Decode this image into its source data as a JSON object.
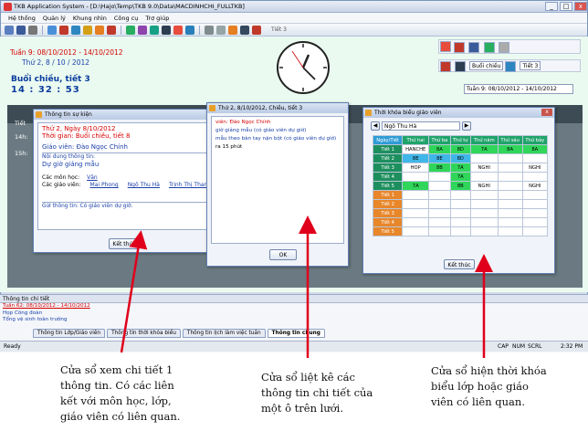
{
  "app": {
    "title": "TKB Application System - [D:\\Hajo\\Temp\\TKB 9.0\\Data\\MACDINHCHI_FULLTKB]"
  },
  "menu": [
    "Hệ thống",
    "Quản lý",
    "Khung nhìn",
    "Công cụ",
    "Trợ giúp"
  ],
  "toolbar": {
    "label": "Tiết 3"
  },
  "header": {
    "week": "Tuần 9: 08/10/2012 - 14/10/2012",
    "day": "Thứ 2, 8 / 10 / 2012",
    "session": "Buổi chiều, tiết 3",
    "time": "14 : 32 : 53"
  },
  "right_panel": {
    "combo1": "Buổi chiều",
    "combo2": "Tiết 3",
    "week_select": "Tuần 9: 08/10/2012 - 14/10/2012"
  },
  "grid": {
    "rows": [
      "Tiết",
      "14h:",
      "15h:",
      "",
      "",
      ""
    ]
  },
  "dlg1": {
    "title": "Thông tin sự kiện",
    "date": "Thứ 2, Ngày 8/10/2012",
    "time": "Thời gian: Buổi chiều, tiết 8",
    "teacher": "Giáo viên: Đào Ngọc Chính",
    "content_label": "Nội dung thông tin:",
    "content": "Dự giờ giảng mẫu",
    "subjects_label": "Các môn học:",
    "subject": "Văn",
    "teachers_label": "Các giáo viên:",
    "teachers": [
      "Mai Phong",
      "Ngô Thu Hà",
      "Trịnh Thị Thanh Tú"
    ],
    "summary": "Gửi thông tin: Có giáo viên dự giờ.",
    "close": "Kết thúc"
  },
  "dlg2": {
    "title": "Thứ 2, 8/10/2012, Chiều, tiết 3",
    "lines": [
      "viên: Đào Ngọc Chính",
      "giờ giảng mẫu (có giáo viên dự giờ)",
      "mẫu theo bàn tay nặn bột (có giáo viên dự giờ)",
      "ra 15 phút"
    ],
    "ok": "OK"
  },
  "dlg3": {
    "title": "Thời khóa biểu giáo viên",
    "teacher": "Ngô Thu Hà",
    "headers": [
      "Ngày/Tiết",
      "Thứ hai",
      "Thứ ba",
      "Thứ tư",
      "Thứ năm",
      "Thứ sáu",
      "Thứ bảy"
    ],
    "rows": [
      {
        "label": "Tiết 1",
        "cells": [
          "HANCHE",
          "8A",
          "8D",
          "7A",
          "8A",
          "8A"
        ]
      },
      {
        "label": "Tiết 2",
        "cells": [
          "8E",
          "8E",
          "8D",
          "",
          "",
          ""
        ]
      },
      {
        "label": "Tiết 3",
        "cells": [
          "HOP",
          "8B",
          "7A",
          "NGHI",
          "",
          "NGHI"
        ]
      },
      {
        "label": "Tiết 4",
        "cells": [
          "",
          "",
          "7A",
          "",
          "",
          ""
        ]
      },
      {
        "label": "Tiết 5",
        "cells": [
          "7A",
          "",
          "8B",
          "NGHI",
          "",
          "NGHI"
        ]
      },
      {
        "label": "Tiết 1",
        "cells": [
          "",
          "",
          "",
          "",
          "",
          ""
        ]
      },
      {
        "label": "Tiết 2",
        "cells": [
          "",
          "",
          "",
          "",
          "",
          ""
        ]
      },
      {
        "label": "Tiết 3",
        "cells": [
          "",
          "",
          "",
          "",
          "",
          ""
        ]
      },
      {
        "label": "Tiết 4",
        "cells": [
          "",
          "",
          "",
          "",
          "",
          ""
        ]
      },
      {
        "label": "Tiết 5",
        "cells": [
          "",
          "",
          "",
          "",
          "",
          ""
        ]
      }
    ],
    "close": "Kết thúc"
  },
  "detail_panel": {
    "title": "Thông tin chi tiết",
    "week": "Tuần 62: 08/10/2012 - 14/10/2012",
    "items": [
      "Họp Công đoàn",
      "Tổng vệ sinh toàn trường"
    ]
  },
  "tabs": [
    "Thông tin Lớp/Giáo viên",
    "Thông tin thời khóa biểu",
    "Thông tin lịch làm việc tuần",
    "Thông tin chung"
  ],
  "status": {
    "left": "Ready",
    "cap": "CAP",
    "num": "NUM",
    "scrl": "SCRL",
    "time": "2:32 PM"
  },
  "annotations": {
    "a1": [
      "Cửa sổ xem chi tiết 1",
      "thông tin. Có các liên",
      "kết với môn học, lớp,",
      "giáo viên có liên quan."
    ],
    "a2": [
      "Cửa sổ liệt kê các",
      "thông tin chi tiết của",
      "một ô trên lưới."
    ],
    "a3": [
      "Cửa sổ hiện thời khóa",
      "biểu lớp hoặc giáo",
      "viên có liên quan."
    ]
  }
}
